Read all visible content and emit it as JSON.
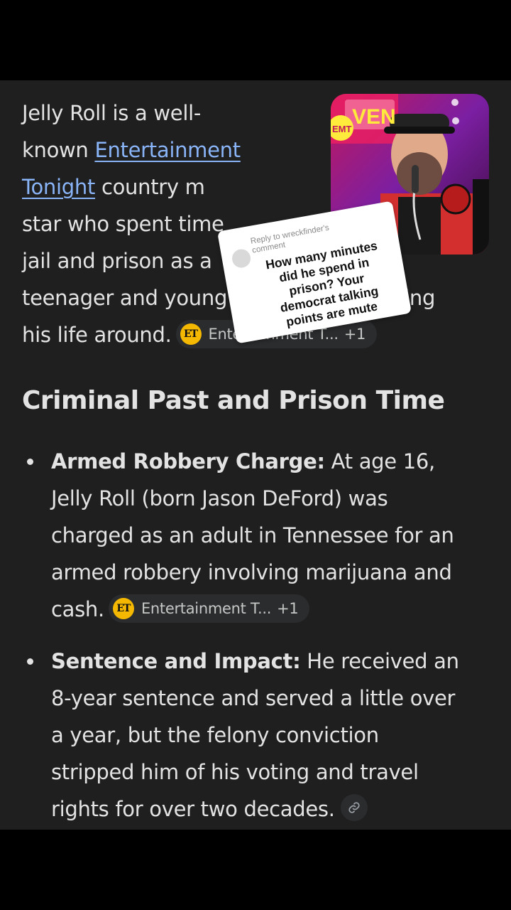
{
  "article": {
    "intro": {
      "line1": "Jelly Roll is a well-",
      "line2_pre": "known ",
      "line2_link": "Entertainment",
      "line3_link": "Tonight",
      "line3_post": " country m",
      "line4": "star who spent time",
      "line5": "jail and prison as a",
      "line6": "teenager and young adult before turning",
      "line7": "his life around.",
      "source_chip": {
        "logo": "ET",
        "label": "Entertainment T...",
        "count": "+1"
      }
    },
    "heading": "Criminal Past and Prison Time",
    "bullets": [
      {
        "title": "Armed Robbery Charge:",
        "line1_rest": " At age 16,",
        "line2": "Jelly Roll (born Jason DeFord) was",
        "line3": "charged as an adult in Tennessee for an",
        "line4": "armed robbery involving marijuana and",
        "line5": "cash.",
        "source_chip": {
          "logo": "ET",
          "label": "Entertainment T...",
          "count": "+1"
        }
      },
      {
        "title": "Sentence and Impact:",
        "line1_rest": " He received an",
        "line2": "8-year sentence and served a little over",
        "line3": "a year, but the felony conviction",
        "line4": "stripped him of his voting and travel",
        "line5": "rights for over two decades.",
        "link_icon": "link-icon"
      }
    ]
  },
  "reply_sticker": {
    "reply_label": "Reply to wreckfinder's comment",
    "comment": "How many minutes did he spend in prison? Your democrat talking points are mute"
  },
  "photo": {
    "badge_text": "VEN",
    "badge2_text": "EMT"
  },
  "colors": {
    "background": "#1f1f1f",
    "text": "#e3e3e3",
    "link": "#8ab4f8",
    "chip_bg": "#2b2c2e",
    "et_logo": "#f5b800"
  }
}
